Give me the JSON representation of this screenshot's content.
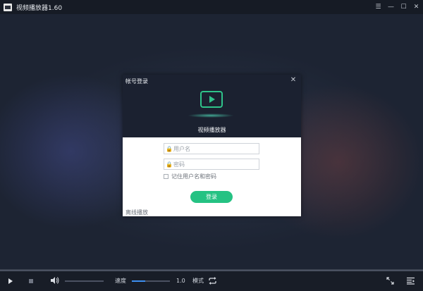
{
  "app": {
    "title": "视频播放器1.60",
    "controls": [
      "minimize-menu",
      "minimize",
      "maximize",
      "close"
    ]
  },
  "dialog": {
    "title": "帐号登录",
    "brand_name": "视频播放器",
    "username_placeholder": "用户名",
    "password_placeholder": "密码",
    "remember_label": "记住用户名和密码",
    "login_label": "登录",
    "offline_label": "离线播放",
    "accent": "#25c283"
  },
  "controlbar": {
    "speed_label": "速度",
    "speed_value": "1.0",
    "speed_fraction": 0.35,
    "mode_label": "模式",
    "volume_fraction": 0.0
  }
}
